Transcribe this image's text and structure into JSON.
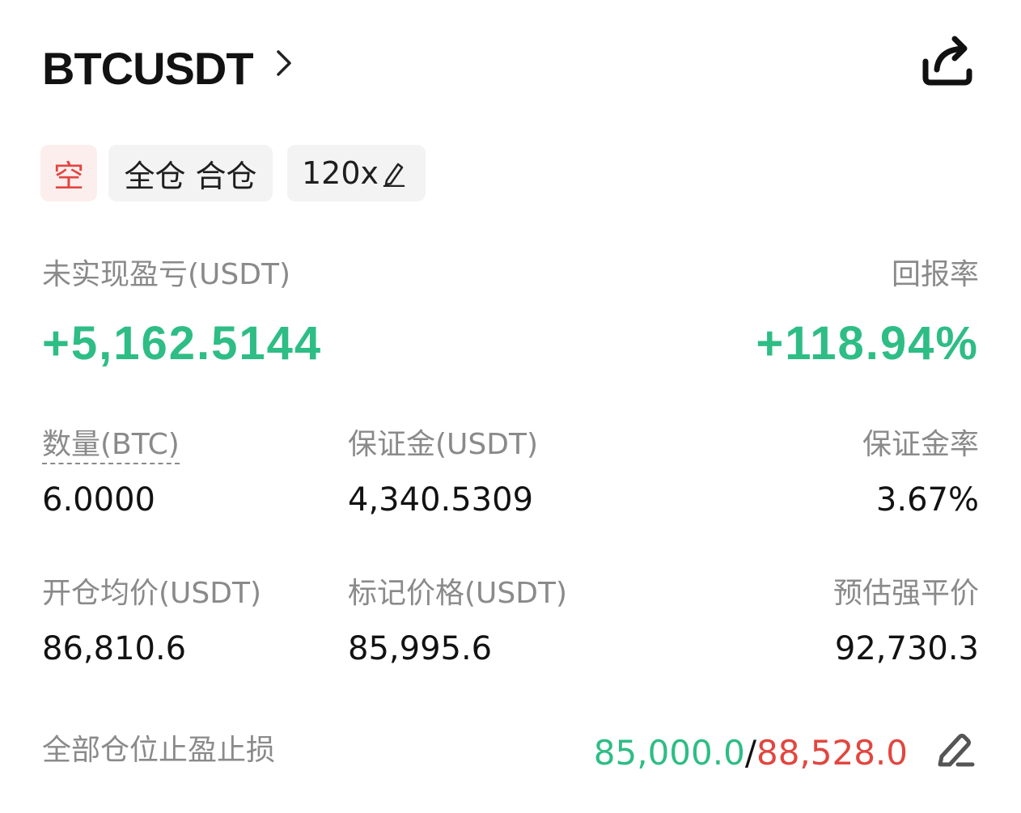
{
  "header": {
    "symbol": "BTCUSDT",
    "chevron_icon": "chevron-right-icon",
    "share_icon": "share-icon"
  },
  "tags": {
    "side": "空",
    "margin_mode": "全仓 合仓",
    "leverage": "120x",
    "leverage_edit_icon": "pencil-icon"
  },
  "pnl": {
    "unrealized_label": "未实现盈亏(USDT)",
    "unrealized_value": "+5,162.5144",
    "roi_label": "回报率",
    "roi_value": "+118.94%"
  },
  "row1": {
    "qty_label": "数量(BTC)",
    "qty_value": "6.0000",
    "margin_label": "保证金(USDT)",
    "margin_value": "4,340.5309",
    "margin_ratio_label": "保证金率",
    "margin_ratio_value": "3.67%"
  },
  "row2": {
    "entry_label": "开仓均价(USDT)",
    "entry_value": "86,810.6",
    "mark_label": "标记价格(USDT)",
    "mark_value": "85,995.6",
    "liq_label": "预估强平价",
    "liq_value": "92,730.3"
  },
  "tpsl": {
    "label": "全部仓位止盈止损",
    "tp_value": "85,000.0",
    "separator": "/",
    "sl_value": "88,528.0",
    "edit_icon": "edit-icon"
  },
  "colors": {
    "profit": "#2ebd85",
    "loss": "#e2463f",
    "text": "#121212",
    "secondary": "#8a8a8a"
  }
}
